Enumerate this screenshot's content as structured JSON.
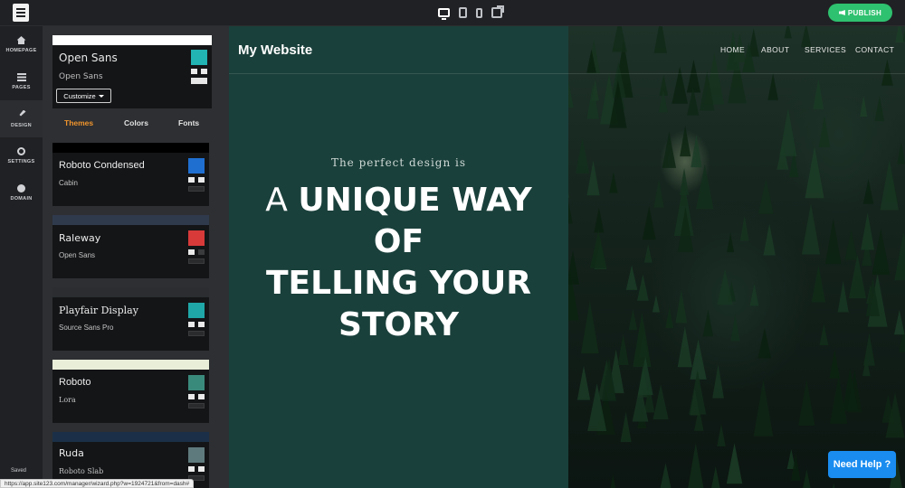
{
  "top": {
    "publish_label": "PUBLISH"
  },
  "nav": {
    "items": [
      {
        "label": "HOMEPAGE",
        "icon": "home-icon"
      },
      {
        "label": "PAGES",
        "icon": "pages-icon"
      },
      {
        "label": "DESIGN",
        "icon": "brush-icon"
      },
      {
        "label": "SETTINGS",
        "icon": "gear-icon"
      },
      {
        "label": "DOMAIN",
        "icon": "globe-icon"
      }
    ],
    "saved_label": "Saved"
  },
  "current_theme": {
    "heading_font": "Open Sans",
    "body_font": "Open Sans",
    "customize_label": "Customize",
    "accent": "#22b3b3"
  },
  "tabs": [
    "Themes",
    "Colors",
    "Fonts"
  ],
  "themes": [
    {
      "name": "Roboto Condensed",
      "sub": "Cabin",
      "strip": "#000000",
      "accent": "#1f6fd1"
    },
    {
      "name": "Raleway",
      "sub": "Open Sans",
      "strip": "#2f3a4d",
      "accent": "#d83a3a"
    },
    {
      "name": "Playfair Display",
      "sub": "Source Sans Pro",
      "strip": "#2b2d30",
      "accent": "#1fa7a7"
    },
    {
      "name": "Roboto",
      "sub": "Lora",
      "strip": "#e9eed9",
      "accent": "#3a8a7c"
    },
    {
      "name": "Ruda",
      "sub": "Roboto Slab",
      "strip": "#1b3048",
      "accent": "#5f7a7d"
    }
  ],
  "status_url": "https://app.site123.com/manager/wizard.php?w=1924721&from=dash#",
  "site": {
    "title": "My Website",
    "menu": [
      "HOME",
      "ABOUT",
      "SERVICES",
      "CONTACT"
    ],
    "tagline": "The perfect design is",
    "hero_thin": "A",
    "hero_line1": "UNIQUE WAY",
    "hero_line2": "OF",
    "hero_line3": "TELLING YOUR",
    "hero_line4": "STORY",
    "pane_color": "#1a403b"
  },
  "help_label": "Need Help ?"
}
